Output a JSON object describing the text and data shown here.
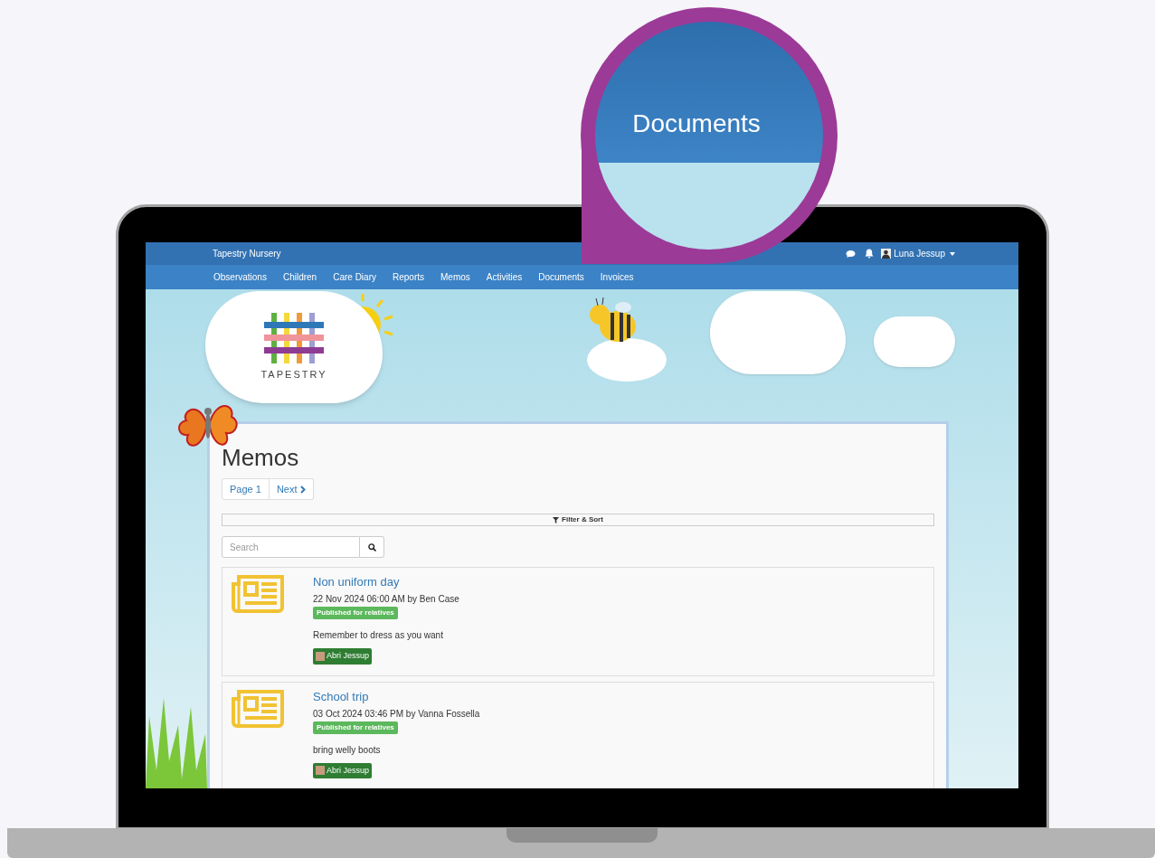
{
  "magnifier": {
    "label": "Documents"
  },
  "topbar": {
    "site_name": "Tapestry Nursery",
    "user": "Luna Jessup"
  },
  "nav": [
    {
      "label": "Observations"
    },
    {
      "label": "Children"
    },
    {
      "label": "Care Diary"
    },
    {
      "label": "Reports"
    },
    {
      "label": "Memos"
    },
    {
      "label": "Activities"
    },
    {
      "label": "Documents"
    },
    {
      "label": "Invoices"
    }
  ],
  "logo": {
    "text": "TAPESTRY"
  },
  "page": {
    "title": "Memos",
    "pagination": [
      "Page 1",
      "Next"
    ],
    "filter_button": "Filter & Sort",
    "search": {
      "placeholder": "Search"
    }
  },
  "memos": [
    {
      "title": "Non uniform day",
      "meta": "22 Nov 2024 06:00 AM by Ben Case",
      "status": "Published for relatives",
      "body": "Remember to dress as you want",
      "child": "Abri Jessup"
    },
    {
      "title": "School trip",
      "meta": "03 Oct 2024 03:46 PM by Vanna Fossella",
      "status": "Published for relatives",
      "body": "bring welly boots",
      "child": "Abri Jessup"
    }
  ]
}
